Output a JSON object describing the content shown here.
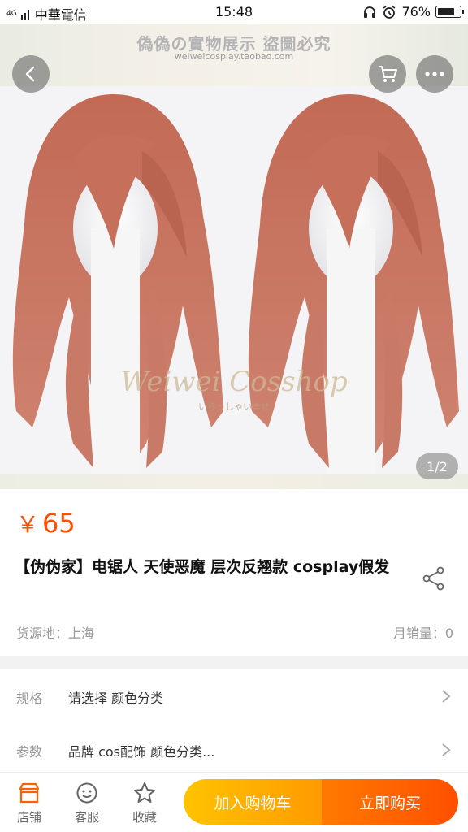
{
  "status_bar": {
    "signal": "4G",
    "carrier": "中華電信",
    "time": "15:48",
    "battery": "76%",
    "icons": [
      "headphone-icon",
      "alarm-icon",
      "battery-icon"
    ]
  },
  "gallery": {
    "banner_title": "偽偽の實物展示 盜圖必究",
    "banner_subtitle": "weiweicosplay.taobao.com",
    "watermark": "Weiwei Cosshop",
    "watermark_sub": "いらっしゃいませ",
    "page_indicator": "1/2",
    "hair_color": "#c8715b"
  },
  "product": {
    "price_symbol": "￥",
    "price": "65",
    "title": "【伪伪家】电锯人 天使恶魔 层次反翘款 cosplay假发",
    "origin": "货源地：上海",
    "monthly_sales": "月销量：0"
  },
  "specs": [
    {
      "label": "规格",
      "value": "请选择 颜色分类"
    },
    {
      "label": "参数",
      "value": "品牌 cos配饰 颜色分类..."
    }
  ],
  "bottom_bar": {
    "shop": "店铺",
    "service": "客服",
    "favorite": "收藏",
    "add_to_cart": "加入购物车",
    "buy_now": "立即购买"
  },
  "colors": {
    "accent": "#ff5000",
    "cart_button": "#ffb000",
    "buy_button": "#ff6000"
  }
}
